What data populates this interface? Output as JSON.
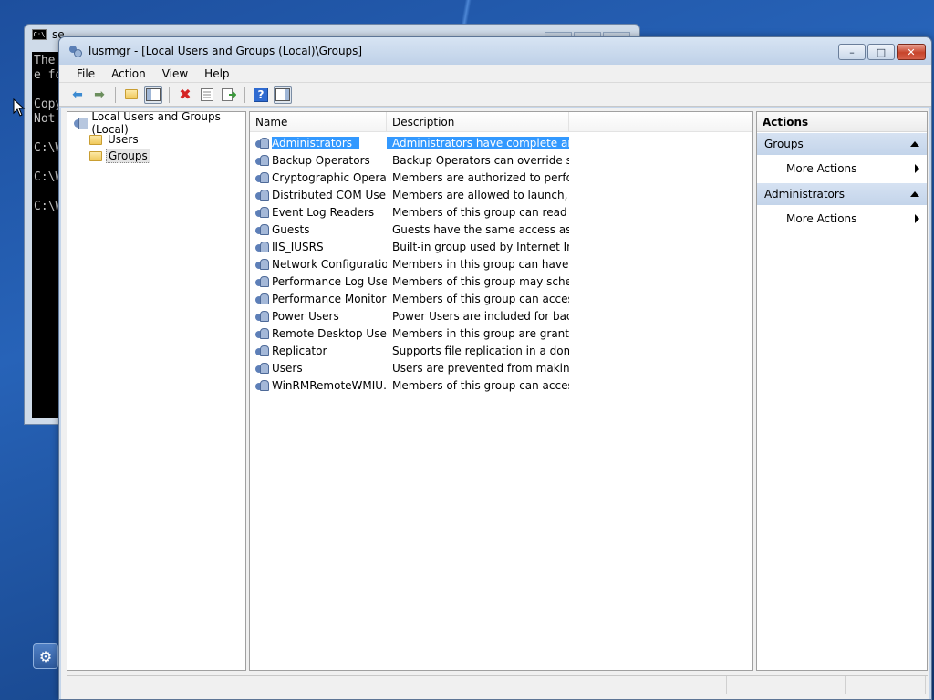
{
  "console": {
    "title": "se",
    "lines": [
      "The",
      "e fo",
      "",
      "Copy",
      "Not",
      "",
      "C:\\W",
      "",
      "C:\\W",
      "",
      "C:\\W"
    ]
  },
  "window": {
    "title": "lusrmgr - [Local Users and Groups (Local)\\Groups]",
    "caption": {
      "minimize": "–",
      "maximize": "□",
      "close": "✕"
    }
  },
  "menu": [
    "File",
    "Action",
    "View",
    "Help"
  ],
  "toolbar": {
    "icons": [
      "back-arrow-icon",
      "forward-arrow-icon",
      "up-folder-icon",
      "show-hide-tree-icon",
      "delete-icon",
      "properties-icon",
      "export-list-icon",
      "help-icon",
      "show-hide-action-pane-icon"
    ]
  },
  "tree": {
    "root": "Local Users and Groups (Local)",
    "children": [
      "Users",
      "Groups"
    ],
    "selected": "Groups"
  },
  "list": {
    "columns": [
      "Name",
      "Description"
    ],
    "rows": [
      {
        "name": "Administrators",
        "desc": "Administrators have complete an..."
      },
      {
        "name": "Backup Operators",
        "desc": "Backup Operators can override se..."
      },
      {
        "name": "Cryptographic Operat...",
        "desc": "Members are authorized to perfor..."
      },
      {
        "name": "Distributed COM Users",
        "desc": "Members are allowed to launch, a..."
      },
      {
        "name": "Event Log Readers",
        "desc": "Members of this group can read e..."
      },
      {
        "name": "Guests",
        "desc": "Guests have the same access as m..."
      },
      {
        "name": "IIS_IUSRS",
        "desc": "Built-in group used by Internet Inf..."
      },
      {
        "name": "Network Configuratio...",
        "desc": "Members in this group can have s..."
      },
      {
        "name": "Performance Log Users",
        "desc": "Members of this group may sche..."
      },
      {
        "name": "Performance Monitor ...",
        "desc": "Members of this group can acces..."
      },
      {
        "name": "Power Users",
        "desc": "Power Users are included for back..."
      },
      {
        "name": "Remote Desktop Users",
        "desc": "Members in this group are grante..."
      },
      {
        "name": "Replicator",
        "desc": "Supports file replication in a dom..."
      },
      {
        "name": "Users",
        "desc": "Users are prevented from making ..."
      },
      {
        "name": "WinRMRemoteWMIU...",
        "desc": "Members of this group can acces..."
      }
    ],
    "selected_index": 0,
    "selection_color": "#3399ff"
  },
  "actions": {
    "title": "Actions",
    "sections": [
      {
        "label": "Groups",
        "items": [
          "More Actions"
        ]
      },
      {
        "label": "Administrators",
        "items": [
          "More Actions"
        ]
      }
    ]
  }
}
